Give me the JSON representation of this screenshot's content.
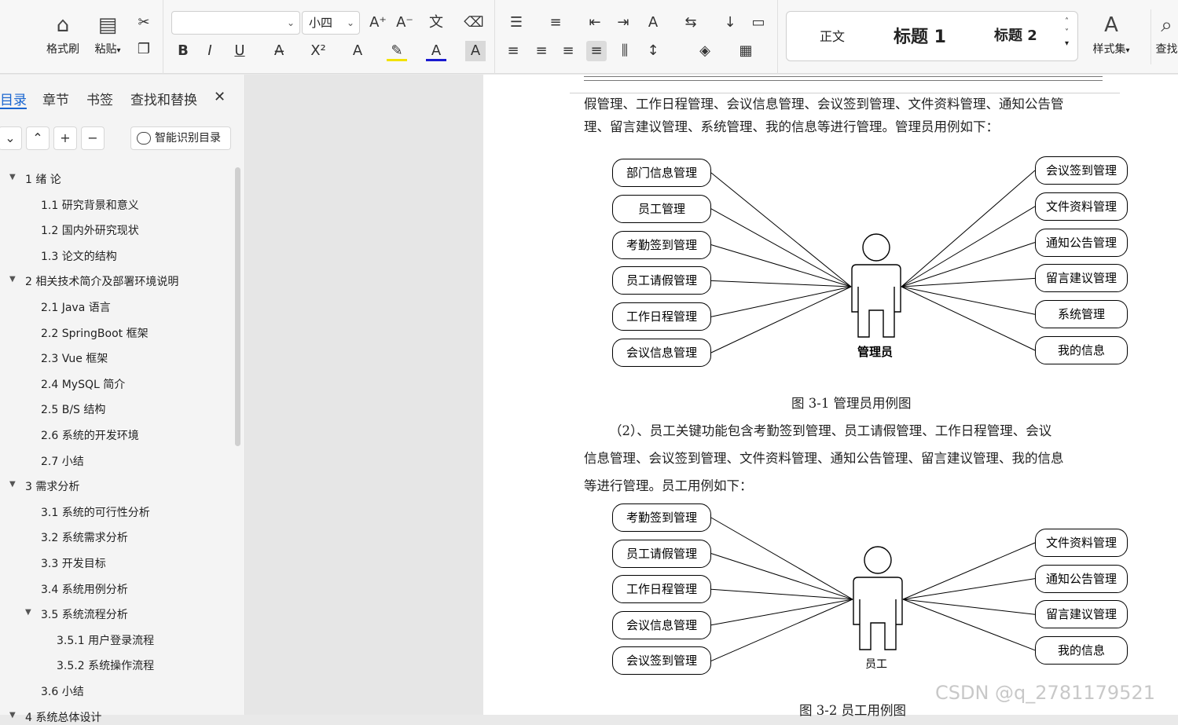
{
  "ribbon": {
    "format_painter": "格式刷",
    "paste": "粘贴",
    "font_name": "",
    "font_size": "小四",
    "styles": {
      "normal": "正文",
      "heading1": "标题 1",
      "heading2": "标题 2",
      "style_set": "样式集"
    },
    "find": "查找"
  },
  "sidebar": {
    "tabs": [
      "目录",
      "章节",
      "书签",
      "查找和替换"
    ],
    "smart_button": "智能识别目录",
    "toc": [
      {
        "label": "1  绪   论",
        "level": 1
      },
      {
        "label": "1.1 研究背景和意义",
        "level": 2
      },
      {
        "label": "1.2 国内外研究现状",
        "level": 2
      },
      {
        "label": "1.3 论文的结构",
        "level": 2
      },
      {
        "label": "2  相关技术简介及部署环境说明",
        "level": 1
      },
      {
        "label": "2.1 Java 语言",
        "level": 2
      },
      {
        "label": "2.2 SpringBoot 框架",
        "level": 2
      },
      {
        "label": "2.3 Vue 框架",
        "level": 2
      },
      {
        "label": "2.4 MySQL 简介",
        "level": 2
      },
      {
        "label": "2.5 B/S 结构",
        "level": 2
      },
      {
        "label": "2.6 系统的开发环境",
        "level": 2
      },
      {
        "label": "2.7 小结",
        "level": 2
      },
      {
        "label": "3  需求分析",
        "level": 1
      },
      {
        "label": "3.1 系统的可行性分析",
        "level": 2
      },
      {
        "label": "3.2 系统需求分析",
        "level": 2
      },
      {
        "label": "3.3 开发目标",
        "level": 2
      },
      {
        "label": "3.4  系统用例分析",
        "level": 2
      },
      {
        "label": "3.5 系统流程分析",
        "level": 2
      },
      {
        "label": "3.5.1  用户登录流程",
        "level": 3
      },
      {
        "label": "3.5.2  系统操作流程",
        "level": 3
      },
      {
        "label": "3.6 小结",
        "level": 2
      },
      {
        "label": "4  系统总体设计",
        "level": 1
      }
    ]
  },
  "document": {
    "para1_line1": "假管理、工作日程管理、会议信息管理、会议签到管理、文件资料管理、通知公告管",
    "para1_line2": "理、留言建议管理、系统管理、我的信息等进行管理。管理员用例如下：",
    "fig1": {
      "actor": "管理员",
      "caption": "图 3-1  管理员用例图",
      "left": [
        "部门信息管理",
        "员工管理",
        "考勤签到管理",
        "员工请假管理",
        "工作日程管理",
        "会议信息管理"
      ],
      "right": [
        "会议签到管理",
        "文件资料管理",
        "通知公告管理",
        "留言建议管理",
        "系统管理",
        "我的信息"
      ]
    },
    "para2_line1": "（2）、员工关键功能包含考勤签到管理、员工请假管理、工作日程管理、会议",
    "para2_line2": "信息管理、会议签到管理、文件资料管理、通知公告管理、留言建议管理、我的信息",
    "para2_line3": "等进行管理。员工用例如下：",
    "fig2": {
      "actor": "员工",
      "caption": "图 3-2  员工用例图",
      "left": [
        "考勤签到管理",
        "员工请假管理",
        "工作日程管理",
        "会议信息管理",
        "会议签到管理"
      ],
      "right": [
        "文件资料管理",
        "通知公告管理",
        "留言建议管理",
        "我的信息"
      ]
    }
  },
  "watermark": "CSDN @q_2781179521"
}
